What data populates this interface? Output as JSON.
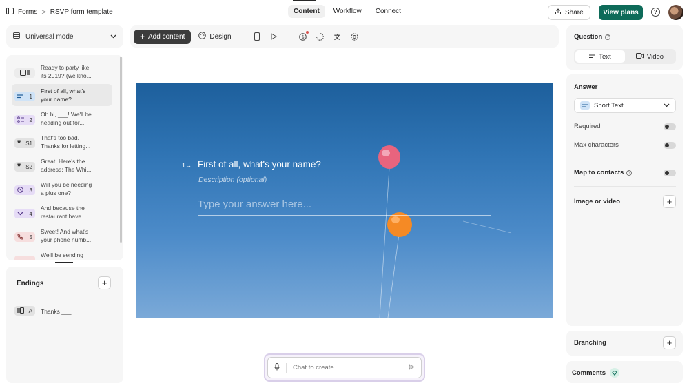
{
  "breadcrumb": {
    "root": "Forms",
    "sep": ">",
    "title": "RSVP form template"
  },
  "nav": {
    "tabs": [
      "Content",
      "Workflow",
      "Connect"
    ],
    "active": "Content"
  },
  "header": {
    "share": "Share",
    "view_plans": "View plans",
    "help": "?"
  },
  "sidebar": {
    "mode": "Universal mode",
    "questions": [
      {
        "num": "",
        "text1": "Ready to party like",
        "text2": "its 2019? (we kno...",
        "color": "#ececec",
        "icon": "welcome-screen-icon"
      },
      {
        "num": "1",
        "text1": "First of all, what's",
        "text2": "your name?",
        "color": "#cfe3f7",
        "icon": "short-text-icon"
      },
      {
        "num": "2",
        "text1": "Oh hi, ___! We'll be",
        "text2": "heading out for...",
        "color": "#e6dcf6",
        "icon": "multiple-choice-icon"
      },
      {
        "num": "S1",
        "text1": "That's too bad.",
        "text2": "Thanks for letting...",
        "color": "#e2e2e2",
        "icon": "statement-icon"
      },
      {
        "num": "S2",
        "text1": "Great! Here's the",
        "text2": "address: The Whi...",
        "color": "#e2e2e2",
        "icon": "statement-icon"
      },
      {
        "num": "3",
        "text1": "Will you be needing",
        "text2": "a plus one?",
        "color": "#f6dede",
        "icon": "yes-no-icon"
      },
      {
        "num": "4",
        "text1": "And because the",
        "text2": "restaurant have...",
        "color": "#e6dcf6",
        "icon": "dropdown-icon"
      },
      {
        "num": "5",
        "text1": "Sweet! And what's",
        "text2": "your phone numb...",
        "color": "#f6dede",
        "icon": "phone-icon"
      },
      {
        "num": "",
        "text1": "We'll be sending",
        "text2": "",
        "color": "#f6dede",
        "icon": "generic-icon"
      }
    ],
    "endings_title": "Endings",
    "endings": [
      {
        "num": "A",
        "text": "Thanks ___!"
      }
    ]
  },
  "toolbar": {
    "add_content": "Add content",
    "design": "Design"
  },
  "canvas": {
    "question_number": "1",
    "question_arrow": "→",
    "question": "First of all, what's your name?",
    "description": "Description (optional)",
    "answer_placeholder": "Type your answer here..."
  },
  "chat": {
    "placeholder": "Chat to create"
  },
  "right": {
    "question_label": "Question",
    "question_types": [
      "Text",
      "Video"
    ],
    "answer_label": "Answer",
    "answer_type": "Short Text",
    "required": "Required",
    "max_chars": "Max characters",
    "map_contacts": "Map to contacts",
    "image_video": "Image or video",
    "branching": "Branching",
    "comments": "Comments"
  },
  "colors": {
    "accent": "#0e6b59",
    "canvas_top": "#1d5f9c",
    "canvas_bottom": "#7aa9d8"
  }
}
